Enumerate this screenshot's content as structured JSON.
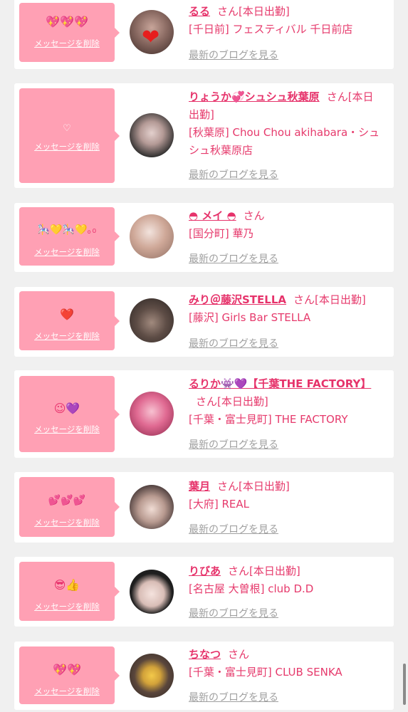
{
  "delete_label": "メッセージを削除",
  "blog_label": "最新のブログを見る",
  "san_label": "さん",
  "today_label": "[本日出勤]",
  "entries": [
    {
      "emoji": "💖💖💖",
      "name": "るる",
      "badge": "さん[本日出勤]",
      "shop": "[千日前] フェスティバル 千日前店",
      "avatar_colors": [
        "#5a3a35",
        "#c8a59a"
      ],
      "avatar_heart": true
    },
    {
      "emoji": "♡",
      "name": "りょうか💞シュシュ秋葉原",
      "badge": "さん[本日出勤]",
      "shop": "[秋葉原] Chou Chou akihabara・シュシュ秋葉原店",
      "avatar_colors": [
        "#2b2b2b",
        "#d9c4c2"
      ]
    },
    {
      "emoji": "🎠💛🎠💛｡₀",
      "name": "◓ メイ ◓",
      "badge": "さん",
      "shop": "[国分町] 華乃",
      "avatar_colors": [
        "#b98f82",
        "#e9d6cf"
      ]
    },
    {
      "emoji": "❤️",
      "name": "みり＠藤沢STELLA",
      "badge": "さん[本日出勤]",
      "shop": "[藤沢] Girls Bar STELLA",
      "avatar_colors": [
        "#3a3230",
        "#a18a7e"
      ]
    },
    {
      "emoji": "😉💜",
      "name": "るりか👾💜【千葉THE FACTORY】",
      "badge": "さん[本日出勤]",
      "shop": "[千葉・富士見町] THE FACTORY",
      "avatar_colors": [
        "#d84d7a",
        "#f4a9c0"
      ]
    },
    {
      "emoji": "💕💕💕",
      "name": "葉月",
      "badge": "さん[本日出勤]",
      "shop": "[大府] REAL",
      "avatar_colors": [
        "#3d3030",
        "#e0c8c0"
      ]
    },
    {
      "emoji": "😎👍",
      "name": "りびあ",
      "badge": "さん[本日出勤]",
      "shop": "[名古屋 大曽根] club D.D",
      "avatar_colors": [
        "#1e1e1e",
        "#efd9d4"
      ]
    },
    {
      "emoji": "💖💖",
      "name": "ちなつ",
      "badge": "さん",
      "shop": "[千葉・富士見町] CLUB SENKA",
      "avatar_colors": [
        "#4a3a33",
        "#f0c23a"
      ]
    }
  ]
}
